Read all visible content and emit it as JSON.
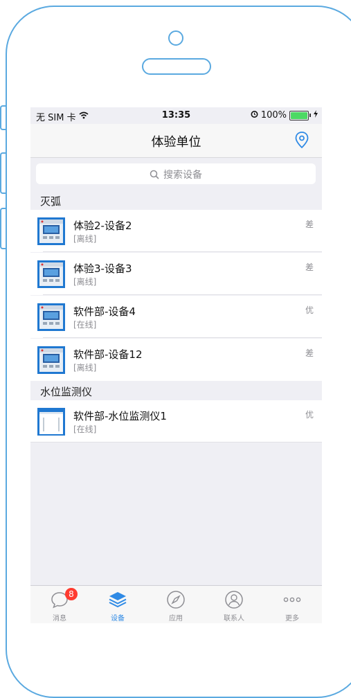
{
  "statusbar": {
    "carrier": "无 SIM 卡",
    "time": "13:35",
    "battery_pct": "100%",
    "battery_level": 1.0,
    "icons": [
      "wifi-icon",
      "alarm-icon",
      "battery-icon",
      "charging-icon"
    ]
  },
  "navbar": {
    "title": "体验单位",
    "right_icon": "location-pin-icon"
  },
  "search": {
    "placeholder": "搜索设备",
    "icon": "search-icon"
  },
  "sections": [
    {
      "header": "灭弧",
      "rows": [
        {
          "title": "体验2-设备2",
          "status": "[离线]",
          "grade": "差",
          "icon": "device-panel-icon"
        },
        {
          "title": "体验3-设备3",
          "status": "[离线]",
          "grade": "差",
          "icon": "device-panel-icon"
        },
        {
          "title": "软件部-设备4",
          "status": "[在线]",
          "grade": "优",
          "icon": "device-panel-icon"
        },
        {
          "title": "软件部-设备12",
          "status": "[离线]",
          "grade": "差",
          "icon": "device-panel-icon"
        }
      ]
    },
    {
      "header": "水位监测仪",
      "rows": [
        {
          "title": "软件部-水位监测仪1",
          "status": "[在线]",
          "grade": "优",
          "icon": "water-level-icon"
        }
      ]
    }
  ],
  "tabbar": {
    "tabs": [
      {
        "label": "消息",
        "icon": "message-icon",
        "badge": "8"
      },
      {
        "label": "设备",
        "icon": "layers-icon",
        "active": true
      },
      {
        "label": "应用",
        "icon": "compass-icon"
      },
      {
        "label": "联系人",
        "icon": "contact-icon"
      },
      {
        "label": "更多",
        "icon": "more-icon"
      }
    ]
  },
  "colors": {
    "accent": "#2f8ae5",
    "frame": "#5aa9e0",
    "badge": "#ff3b30",
    "background": "#efeff4"
  }
}
